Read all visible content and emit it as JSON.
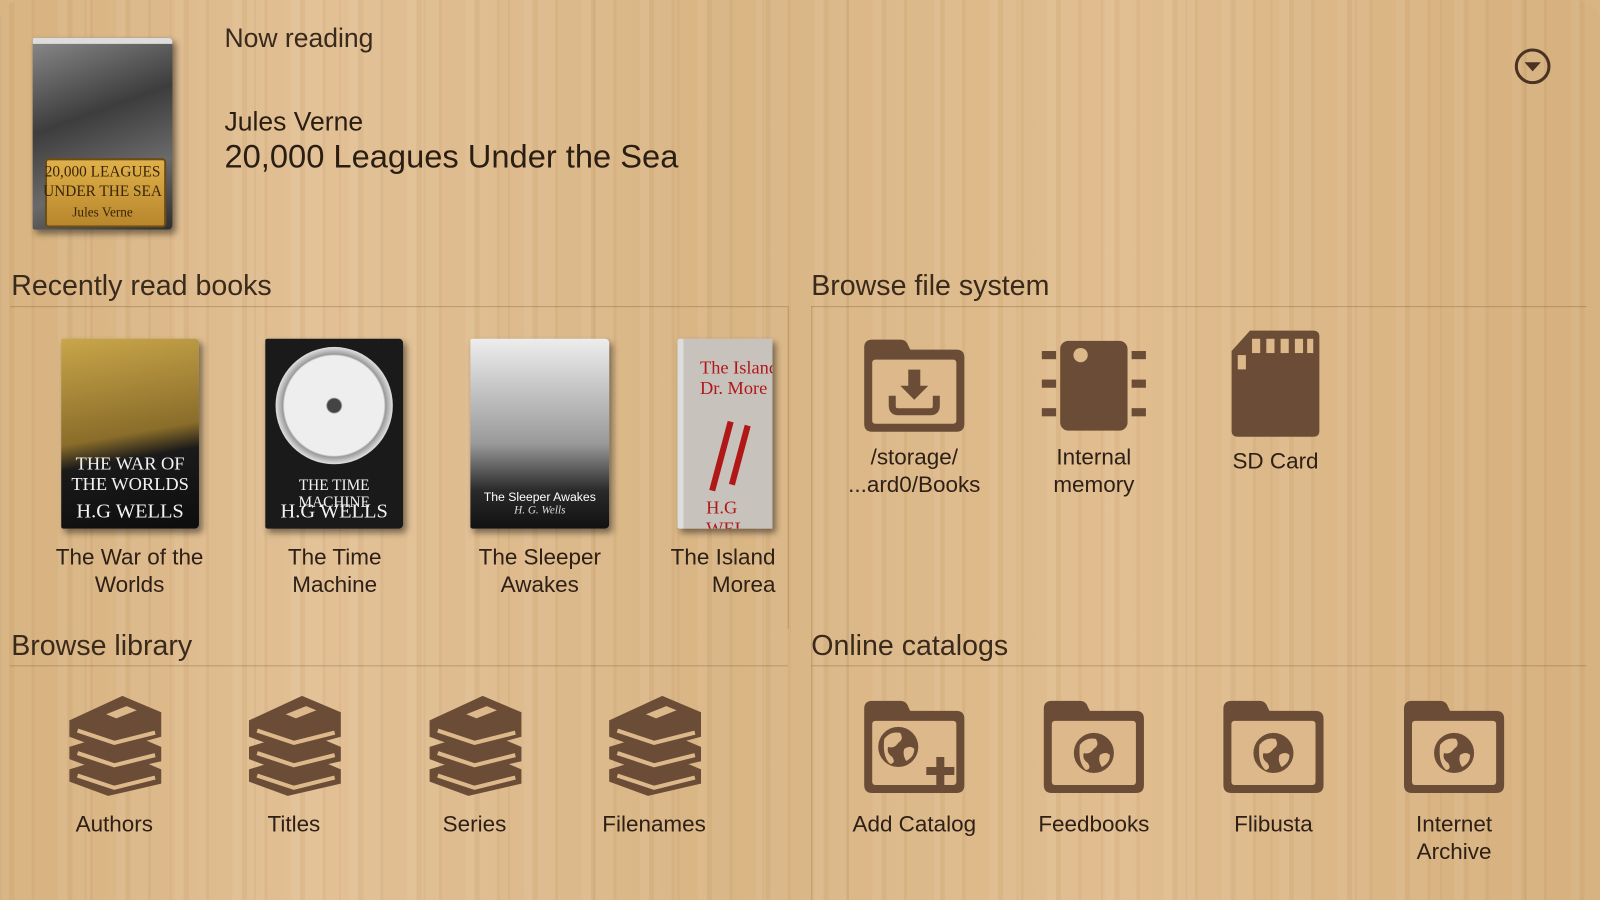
{
  "now_reading": {
    "heading": "Now reading",
    "author": "Jules Verne",
    "title": "20,000 Leagues Under the Sea",
    "cover_text": [
      "20,000 LEAGUES",
      "UNDER THE SEA",
      "Jules Verne"
    ]
  },
  "menu_icon": "dropdown-circle-icon",
  "recent": {
    "heading": "Recently read books",
    "books": [
      {
        "label1": "The War of the",
        "label2": "Worlds",
        "cover1": "THE WAR OF THE WORLDS",
        "cover2": "H.G WELLS"
      },
      {
        "label1": "The Time",
        "label2": "Machine",
        "cover1": "THE TIME MACHINE",
        "cover2": "H.G WELLS"
      },
      {
        "label1": "The Sleeper",
        "label2": "Awakes",
        "cover1": "The Sleeper Awakes",
        "cover2": "H. G. Wells"
      },
      {
        "label1": "The Island",
        "label2": "Morea",
        "cover1": "The Island Dr. More",
        "cover2": "H.G WEL"
      }
    ]
  },
  "filesystem": {
    "heading": "Browse file system",
    "items": [
      {
        "label1": "/storage/",
        "label2": "...ard0/Books",
        "icon": "folder-download-icon"
      },
      {
        "label1": "Internal",
        "label2": "memory",
        "icon": "memory-chip-icon"
      },
      {
        "label1": "SD Card",
        "label2": "",
        "icon": "sd-card-icon"
      }
    ]
  },
  "library": {
    "heading": "Browse library",
    "items": [
      {
        "label": "Authors",
        "icon": "books-stack-icon"
      },
      {
        "label": "Titles",
        "icon": "books-stack-icon"
      },
      {
        "label": "Series",
        "icon": "books-stack-icon"
      },
      {
        "label": "Filenames",
        "icon": "books-stack-icon"
      }
    ]
  },
  "catalogs": {
    "heading": "Online catalogs",
    "items": [
      {
        "label1": "Add Catalog",
        "label2": "",
        "icon": "folder-globe-add-icon"
      },
      {
        "label1": "Feedbooks",
        "label2": "",
        "icon": "folder-globe-icon"
      },
      {
        "label1": "Flibusta",
        "label2": "",
        "icon": "folder-globe-icon"
      },
      {
        "label1": "Internet",
        "label2": "Archive",
        "icon": "folder-globe-icon"
      }
    ]
  },
  "colors": {
    "icon": "#6b4c36",
    "wood": "#dcb88a",
    "text": "#2a1d12"
  }
}
